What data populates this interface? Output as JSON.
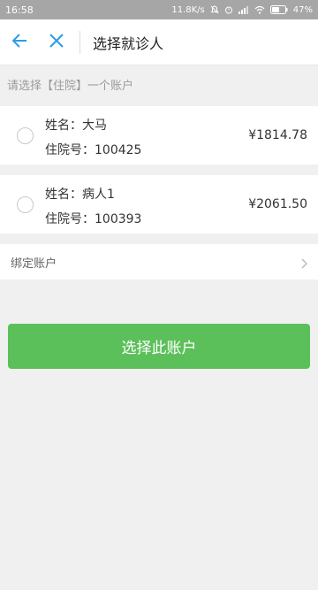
{
  "status_bar": {
    "time": "16:58",
    "network_speed": "11.8K/s",
    "battery": "47%"
  },
  "nav": {
    "title": "选择就诊人",
    "back_icon": "back-arrow-icon",
    "close_icon": "close-icon"
  },
  "hint": "请选择【住院】一个账户",
  "accounts": [
    {
      "name_line": "姓名：大马",
      "id_line": "住院号：100425",
      "amount": "¥1814.78"
    },
    {
      "name_line": "姓名：病人1",
      "id_line": "住院号：100393",
      "amount": "¥2061.50"
    }
  ],
  "bind_account": {
    "label": "绑定账户"
  },
  "primary_button": {
    "label": "选择此账户"
  },
  "colors": {
    "accent_blue": "#2f9be8",
    "primary_green": "#5cc05a",
    "status_bar_bg": "#a6a6a6"
  }
}
